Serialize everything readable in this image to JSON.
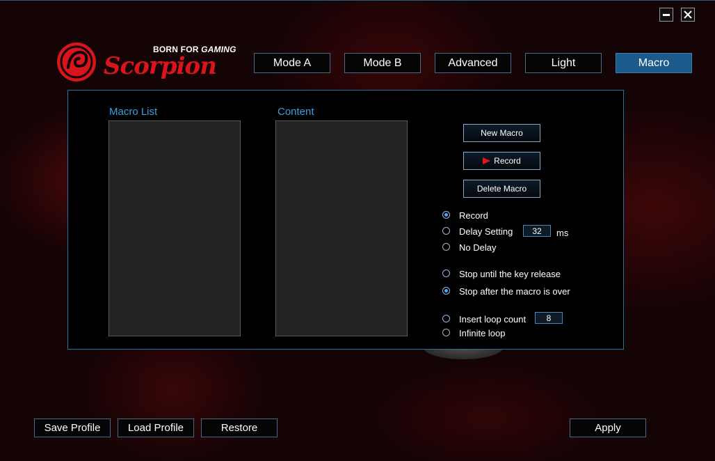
{
  "window": {
    "minimize_icon": "minimize-icon",
    "close_icon": "close-icon"
  },
  "brand": {
    "tag_prefix": "BORN FOR",
    "tag_emphasis": "GAMING",
    "wordmark": "Scorpion",
    "emblem_color": "#d8141c"
  },
  "tabs": [
    {
      "label": "Mode A",
      "active": false
    },
    {
      "label": "Mode B",
      "active": false
    },
    {
      "label": "Advanced",
      "active": false
    },
    {
      "label": "Light",
      "active": false
    },
    {
      "label": "Macro",
      "active": true
    }
  ],
  "macro": {
    "list_label": "Macro List",
    "content_label": "Content",
    "macro_list_items": [],
    "content_items": [],
    "buttons": {
      "new_macro": "New Macro",
      "record": "Record",
      "delete_macro": "Delete Macro"
    },
    "delay_options": [
      {
        "label": "Record",
        "checked": true
      },
      {
        "label": "Delay Setting",
        "checked": false
      },
      {
        "label": "No Delay",
        "checked": false
      }
    ],
    "delay_value": "32",
    "delay_unit": "ms",
    "stop_options": [
      {
        "label": "Stop until the key release",
        "checked": false
      },
      {
        "label": "Stop after the macro is over",
        "checked": true
      }
    ],
    "loop_options": [
      {
        "label": "Insert loop count",
        "checked": false
      },
      {
        "label": "Infinite loop",
        "checked": false
      }
    ],
    "loop_count": "8"
  },
  "footer": {
    "save_profile": "Save Profile",
    "load_profile": "Load Profile",
    "restore": "Restore",
    "apply": "Apply"
  },
  "colors": {
    "accent_blue": "#3aa0e0",
    "active_tab": "#1c5a8c",
    "brand_red": "#d8141c"
  }
}
